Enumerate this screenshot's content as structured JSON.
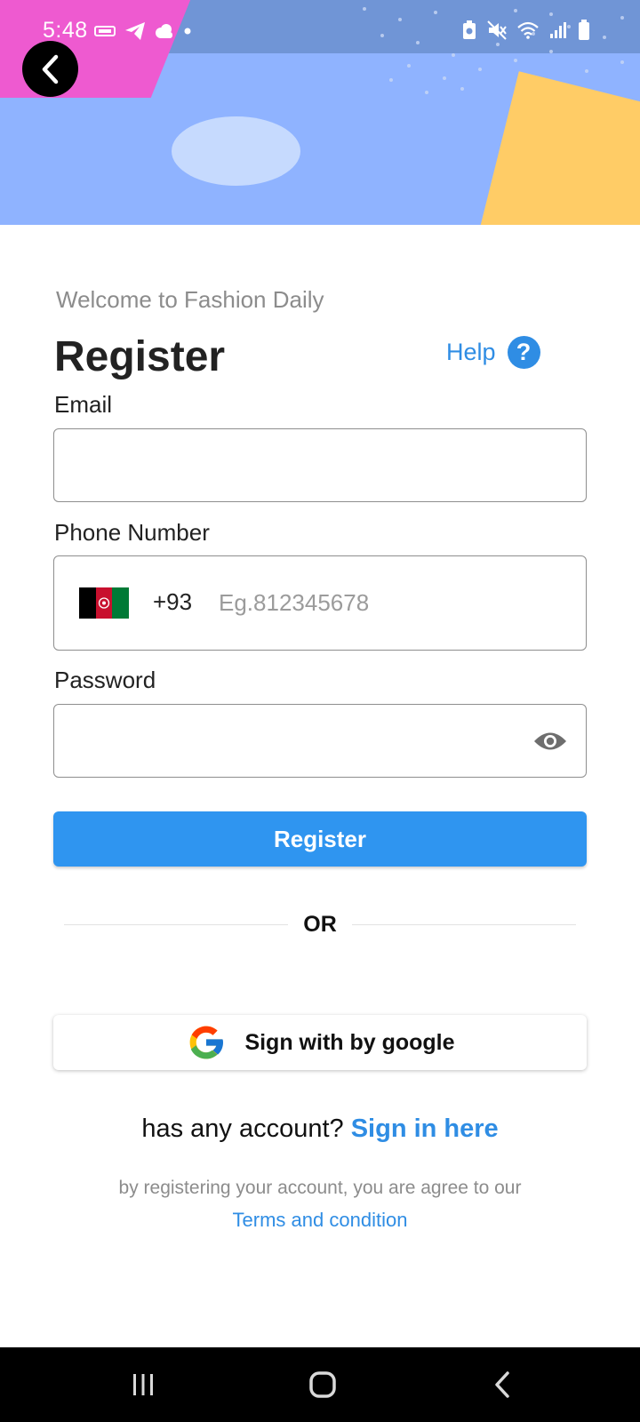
{
  "status_bar": {
    "time": "5:48",
    "left_icons": [
      "data-saver-icon",
      "telegram-icon",
      "cloud-icon",
      "dot-icon"
    ],
    "right_icons": [
      "battery-saver-icon",
      "mute-icon",
      "wifi-icon",
      "signal-icon",
      "battery-icon"
    ]
  },
  "header": {
    "back_icon": "chevron-left-icon",
    "colors": {
      "background": "#8fb3ff",
      "pink": "#ee5ad0",
      "yellow": "#ffcc66",
      "oval": "#c6dafe"
    }
  },
  "welcome_text": "Welcome to Fashion Daily",
  "title": "Register",
  "help": {
    "label": "Help",
    "icon": "question-circle-icon"
  },
  "fields": {
    "email": {
      "label": "Email",
      "value": "",
      "placeholder": ""
    },
    "phone": {
      "label": "Phone Number",
      "country_flag": "afghanistan-flag-icon",
      "country_code": "+93",
      "value": "",
      "placeholder": "Eg.812345678"
    },
    "password": {
      "label": "Password",
      "value": "",
      "placeholder": "",
      "toggle_icon": "eye-icon"
    }
  },
  "register_button": "Register",
  "or_text": "OR",
  "google_button": {
    "label": "Sign with by google",
    "icon": "google-icon"
  },
  "account": {
    "prompt": "has any account?",
    "link": "Sign in here"
  },
  "terms": {
    "text": "by registering your account, you are agree to our",
    "link": "Terms and condition"
  },
  "colors": {
    "accent": "#2f95f0",
    "link": "#2f8de4",
    "muted_text": "#8c8c8c"
  },
  "nav_bar": {
    "icons": [
      "recent-apps-icon",
      "home-icon",
      "back-icon"
    ]
  }
}
